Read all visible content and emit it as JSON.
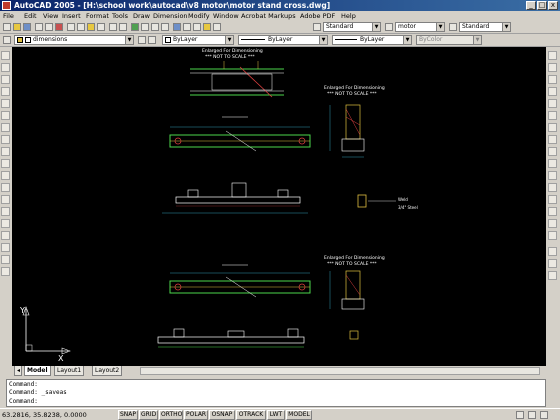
{
  "window": {
    "title": "AutoCAD 2005 - [H:\\school work\\autocad\\v8 motor\\motor stand cross.dwg]",
    "min_glyph": "_",
    "max_glyph": "□",
    "close_glyph": "x"
  },
  "menu": [
    "File",
    "Edit",
    "View",
    "Insert",
    "Format",
    "Tools",
    "Draw",
    "Dimension",
    "Modify",
    "Window",
    "Acrobat Markups",
    "Adobe PDF",
    "Help"
  ],
  "styles_toolbar": {
    "text_style": "Standard",
    "dim_style": "motor",
    "table_style": "Standard"
  },
  "properties_toolbar": {
    "layer": "dimensions",
    "color": "ByLayer",
    "linetype": "ByLayer",
    "lineweight": "ByLayer",
    "plot_style": "ByColor"
  },
  "drawing": {
    "background": "#000000",
    "note_title": "Enlarged For Dimensioning",
    "note_scale": "*** NOT TO SCALE ***",
    "weld_label_1": "Weld",
    "weld_label_2": "3/4\" Steel",
    "ucs_x": "X",
    "ucs_y": "Y"
  },
  "tabs": [
    "Model",
    "Layout1",
    "Layout2"
  ],
  "active_tab": "Model",
  "command": {
    "lines": [
      "Command:",
      "Command: _saveas",
      "Command:"
    ]
  },
  "status": {
    "coords": "63.2816, 35.8238, 0.0000",
    "buttons": [
      "SNAP",
      "GRID",
      "ORTHO",
      "POLAR",
      "OSNAP",
      "OTRACK",
      "LWT",
      "MODEL"
    ]
  },
  "icons": {
    "app": "autocad-logo-icon",
    "ucs": "ucs-axis-icon"
  },
  "colors": {
    "title_start": "#0a246a",
    "title_end": "#3a6ea5",
    "cad_green": "#4cd64c",
    "cad_red": "#e04040",
    "cad_yellow": "#e0c040",
    "cad_white": "#ffffff",
    "cad_cyan": "#40c0e0"
  }
}
